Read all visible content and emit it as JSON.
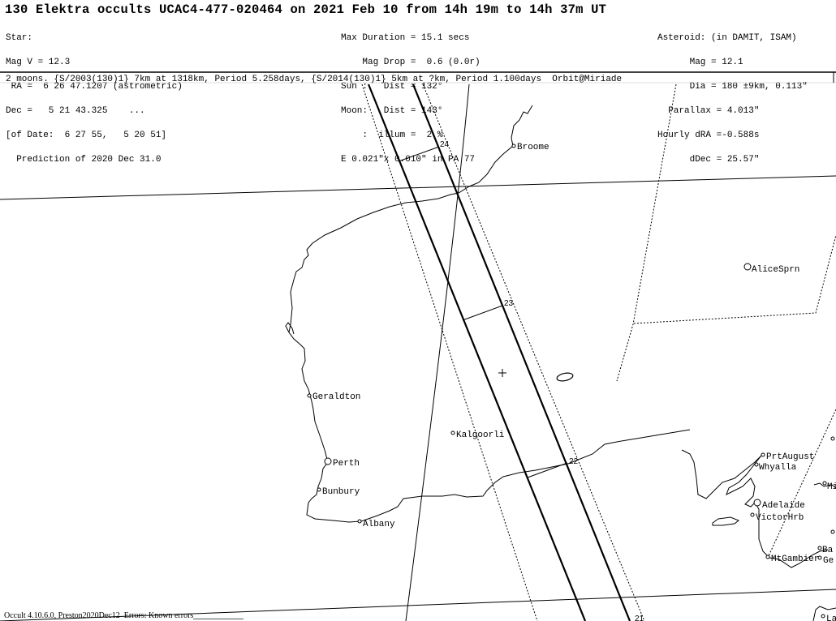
{
  "title": "130 Elektra occults UCAC4-477-020464 on 2021 Feb 10 from 14h 19m to 14h 37m UT",
  "star_block": [
    "Star:",
    "Mag V = 12.3",
    " RA =  6 26 47.1207 (astrometric)",
    "Dec =   5 21 43.325    ...",
    "[of Date:  6 27 55,   5 20 51]",
    "  Prediction of 2020 Dec 31.0"
  ],
  "event_block": [
    "Max Duration = 15.1 secs",
    "    Mag Drop =  0.6 (0.0r)",
    "Sun :   Dist = 132°",
    "Moon:   Dist = 143°",
    "    :  illum =  2 %",
    "E 0.021\"x 0.010\" in PA 77"
  ],
  "asteroid_block": [
    "Asteroid: (in DAMIT, ISAM)",
    "      Mag = 12.1",
    "      Dia = 180 ±9km, 0.113\"",
    "  Parallax = 4.013\"",
    "Hourly dRA =-0.588s",
    "      dDec = 25.57\""
  ],
  "moons_line": "2 moons. {S/2003(130)1} 7km at 1318km, Period 5.258days, {S/2014(130)1} 5km at ?km, Period 1.100days  Orbit@Miriade",
  "footer": "Occult 4.10.6.0, Preston2020Dec12  Errors: Known errors",
  "path_time_marks": [
    "24",
    "23",
    "22",
    "21"
  ],
  "cities": [
    {
      "name": "Broome"
    },
    {
      "name": "AliceSprn"
    },
    {
      "name": "Geraldton"
    },
    {
      "name": "Kalgoorli"
    },
    {
      "name": "Perth"
    },
    {
      "name": "Bunbury"
    },
    {
      "name": "Albany"
    },
    {
      "name": "PrtAugust"
    },
    {
      "name": "Whyalla"
    },
    {
      "name": "Adelaide"
    },
    {
      "name": "VictorHrb"
    },
    {
      "name": "MtGambier"
    },
    {
      "name": "Mi"
    },
    {
      "name": "Ba"
    },
    {
      "name": "Ge"
    },
    {
      "name": "La"
    }
  ]
}
